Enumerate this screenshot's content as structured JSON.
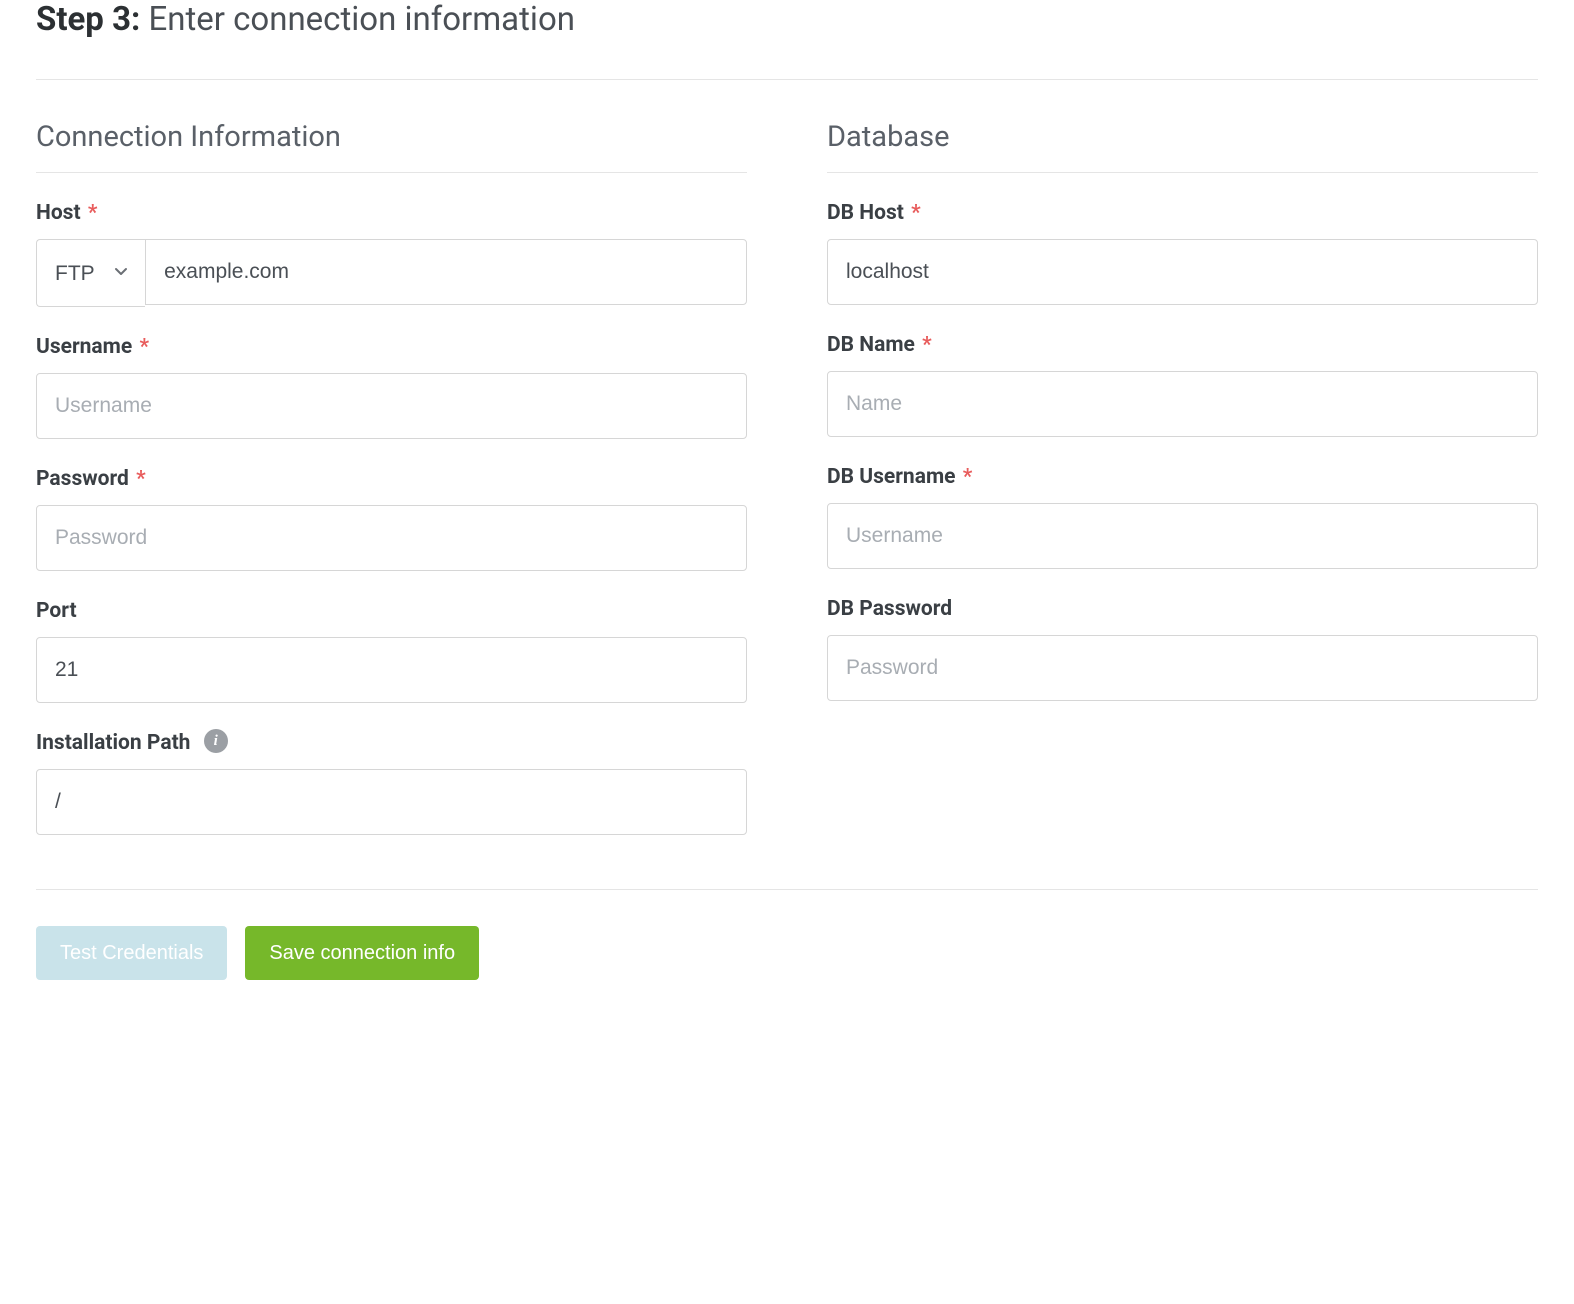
{
  "header": {
    "step_label": "Step 3:",
    "step_title": "Enter connection information"
  },
  "connection": {
    "section_title": "Connection Information",
    "host": {
      "label": "Host",
      "required": "*",
      "protocol": "FTP",
      "value": "example.com"
    },
    "username": {
      "label": "Username",
      "required": "*",
      "placeholder": "Username",
      "value": ""
    },
    "password": {
      "label": "Password",
      "required": "*",
      "placeholder": "Password",
      "value": ""
    },
    "port": {
      "label": "Port",
      "value": "21"
    },
    "install_path": {
      "label": "Installation Path",
      "value": "/"
    }
  },
  "database": {
    "section_title": "Database",
    "db_host": {
      "label": "DB Host",
      "required": "*",
      "value": "localhost"
    },
    "db_name": {
      "label": "DB Name",
      "required": "*",
      "placeholder": "Name",
      "value": ""
    },
    "db_username": {
      "label": "DB Username",
      "required": "*",
      "placeholder": "Username",
      "value": ""
    },
    "db_password": {
      "label": "DB Password",
      "placeholder": "Password",
      "value": ""
    }
  },
  "buttons": {
    "test": "Test Credentials",
    "save": "Save connection info"
  }
}
